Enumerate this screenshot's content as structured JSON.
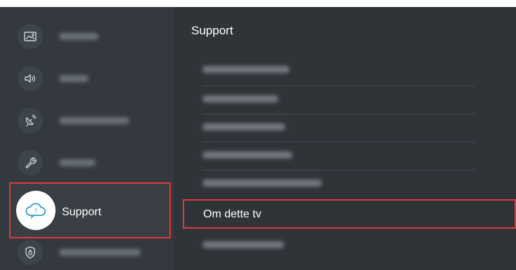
{
  "left_menu": {
    "items": [
      {
        "icon": "picture-icon",
        "label": ""
      },
      {
        "icon": "sound-icon",
        "label": ""
      },
      {
        "icon": "broadcasting-icon",
        "label": ""
      },
      {
        "icon": "general-wrench-icon",
        "label": ""
      },
      {
        "icon": "support-cloud-icon",
        "label": "Support",
        "selected": true
      },
      {
        "icon": "privacy-shield-icon",
        "label": ""
      }
    ]
  },
  "right_panel": {
    "title": "Support",
    "items": [
      {
        "label": ""
      },
      {
        "label": ""
      },
      {
        "label": ""
      },
      {
        "label": ""
      },
      {
        "label": ""
      },
      {
        "label": "Om dette tv",
        "selected": true
      },
      {
        "label": ""
      }
    ]
  },
  "colors": {
    "focus_border": "#e0393b",
    "left_panel_bg": "#34393f",
    "right_panel_bg": "#2f3439",
    "text": "#ffffff"
  }
}
